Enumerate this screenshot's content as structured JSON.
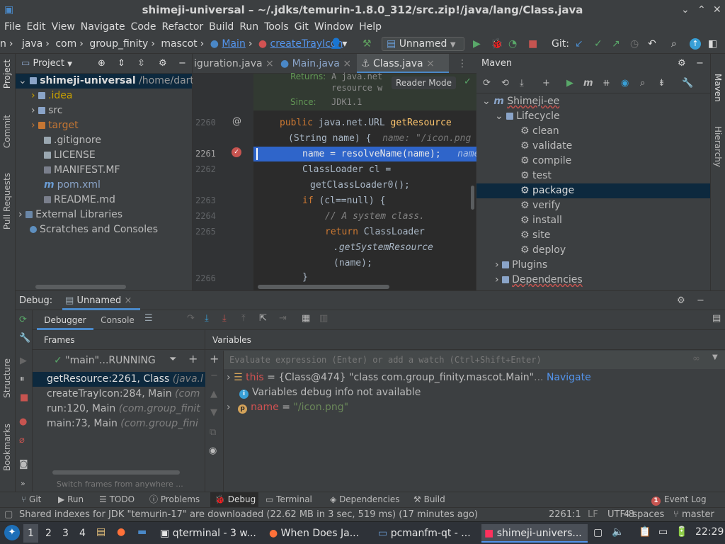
{
  "window": {
    "title": "shimeji-universal – ~/.jdks/temurin-1.8.0_312/src.zip!/java/lang/Class.java"
  },
  "menu": [
    "File",
    "Edit",
    "View",
    "Navigate",
    "Code",
    "Refactor",
    "Build",
    "Run",
    "Tools",
    "Git",
    "Window",
    "Help"
  ],
  "breadcrumbs": [
    "n",
    "java",
    "com",
    "group_finity",
    "mascot",
    "Main",
    "createTrayIcon"
  ],
  "toolbar": {
    "run_config": "Unnamed",
    "git_label": "Git:"
  },
  "project": {
    "header": "Project",
    "root": {
      "name": "shimeji-universal",
      "path": "/home/dartz"
    },
    "items": [
      ".idea",
      "src",
      "target",
      ".gitignore",
      "LICENSE",
      "MANIFEST.MF",
      "pom.xml",
      "README.md"
    ],
    "external": "External Libraries",
    "scratches": "Scratches and Consoles"
  },
  "editor": {
    "tabs": [
      "iguration.java",
      "Main.java",
      "Class.java"
    ],
    "reader_mode": "Reader Mode",
    "lines": {
      "l1": "2260",
      "l2": "2261",
      "l3": "2262",
      "l4": "2263",
      "l5": "2264",
      "l6": "2265",
      "l7": "2266"
    },
    "doc": {
      "returns_label": "Returns:",
      "returns_text": "A java.net",
      "returns_text2": "resource w",
      "since_label": "Since:",
      "since_val": "JDK1.1"
    },
    "code": {
      "sig_mods": "public",
      "sig_type": " java.net.URL ",
      "sig_name": "getResource",
      "params": "(String name) {",
      "param_hint": "name: \"/icon.png",
      "line_current": "name = resolveName(name);",
      "line_current_hint": "name",
      "cl_decl": "ClassLoader cl =",
      "cl_call": "getClassLoader0();",
      "if_kw": "if",
      "if_rest": " (cl==null) {",
      "comment": "// A system class.",
      "ret_kw": "return",
      "ret_rest": " ClassLoader",
      "sys_res": ".getSystemResource",
      "sys_arg": "(name);",
      "brace": "}"
    }
  },
  "maven": {
    "header": "Maven",
    "project": "Shimeji-ee",
    "lifecycle": "Lifecycle",
    "goals": [
      "clean",
      "validate",
      "compile",
      "test",
      "package",
      "verify",
      "install",
      "site",
      "deploy"
    ],
    "selected": "package",
    "plugins": "Plugins",
    "dependencies": "Dependencies"
  },
  "right_tabs": [
    "Maven",
    "Hierarchy"
  ],
  "left_tabs": [
    "Project",
    "Commit",
    "Pull Requests",
    "Structure",
    "Bookmarks"
  ],
  "debug": {
    "header_label": "Debug:",
    "session": "Unnamed",
    "tabs": [
      "Debugger",
      "Console"
    ],
    "frames_header": "Frames",
    "variables_header": "Variables",
    "thread": "\"main\"...RUNNING",
    "frames": [
      {
        "method": "getResource:2261, Class",
        "loc": "(java.l"
      },
      {
        "method": "createTrayIcon:284, Main",
        "loc": "(com"
      },
      {
        "method": "run:120, Main",
        "loc": "(com.group_finit"
      },
      {
        "method": "main:73, Main",
        "loc": "(com.group_fini"
      }
    ],
    "switch_frames": "Switch frames from anywhere ...",
    "eval_placeholder": "Evaluate expression (Enter) or add a watch (Ctrl+Shift+Enter)",
    "vars": {
      "this_name": "this",
      "this_val": "{Class@474} \"class com.group_finity.mascot.Main\"",
      "this_more": "...",
      "navigate": "Navigate",
      "info": "Variables debug info not available",
      "name_name": "name",
      "name_val": "\"/icon.png\""
    }
  },
  "bottom_tabs": [
    "Git",
    "Run",
    "TODO",
    "Problems",
    "Debug",
    "Terminal",
    "Dependencies",
    "Build"
  ],
  "event_log": "Event Log",
  "event_count": "1",
  "status": {
    "message": "Shared indexes for JDK \"temurin-17\" are downloaded (22.62 MB in 3 sec, 519 ms) (17 minutes ago)",
    "position": "2261:1",
    "line_sep": "LF",
    "encoding": "UTF-8",
    "indent": "4 spaces",
    "branch": "master"
  },
  "taskbar": {
    "workspaces": [
      "1",
      "2",
      "3",
      "4"
    ],
    "tasks": [
      "qterminal - 3 w...",
      "When Does Ja...",
      "pcmanfm-qt - ...",
      "shimeji-univers..."
    ],
    "clock": "22:29"
  },
  "colors": {
    "accent": "#4a88c7",
    "selection": "#2f65ca",
    "folder": "#8aa4c8",
    "excluded": "#c57633"
  }
}
